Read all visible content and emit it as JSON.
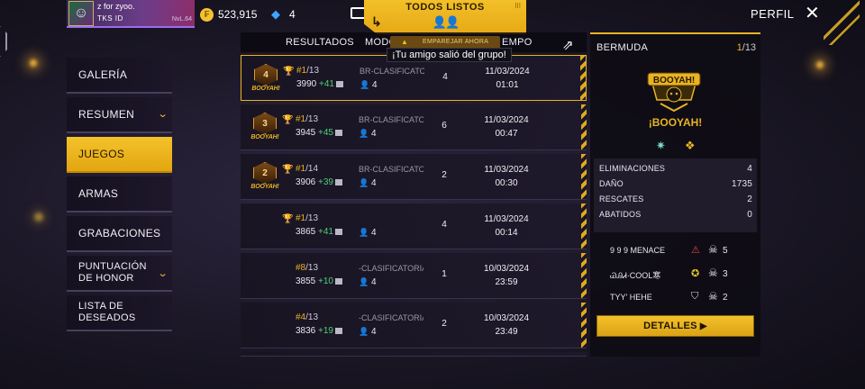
{
  "topbar": {
    "player_name": "z for zyoo.",
    "player_tag": "TKS    ID",
    "player_level": "NvL.64",
    "coins": "523,915",
    "diamonds": "4",
    "ready_text": "TODOS LISTOS",
    "ready_chip": "EMPAREJAR AHORA",
    "ready_mark": "III",
    "profile": "PERFIL"
  },
  "toast": "¡Tu amigo salió del grupo!",
  "sidebar": {
    "items": [
      {
        "label": "GALERÍA"
      },
      {
        "label": "RESUMEN"
      },
      {
        "label": "JUEGOS"
      },
      {
        "label": "ARMAS"
      },
      {
        "label": "GRABACIONES"
      },
      {
        "label": "PUNTUACIÓN DE HONOR"
      },
      {
        "label": "LISTA DE DESEADOS"
      }
    ]
  },
  "table": {
    "headers": {
      "results": "RESULTADOS",
      "mode": "MODO",
      "time": "EMPO"
    },
    "rows": [
      {
        "rank_badge": "4",
        "badge_word": "BOOYAH!",
        "position": "#1",
        "total": "/13",
        "score": "3990",
        "delta": "+41",
        "mode": "BR-CLASIFICATORIA",
        "squad": "4",
        "kills": "4",
        "date": "11/03/2024",
        "time": "01:01"
      },
      {
        "rank_badge": "3",
        "badge_word": "BOOYAH!",
        "position": "#1",
        "total": "/13",
        "score": "3945",
        "delta": "+45",
        "mode": "BR-CLASIFICATORIA",
        "squad": "4",
        "kills": "6",
        "date": "11/03/2024",
        "time": "00:47"
      },
      {
        "rank_badge": "2",
        "badge_word": "BOOYAH!",
        "position": "#1",
        "total": "/14",
        "score": "3906",
        "delta": "+39",
        "mode": "BR-CLASIFICATORIA",
        "squad": "4",
        "kills": "2",
        "date": "11/03/2024",
        "time": "00:30"
      },
      {
        "rank_badge": "",
        "badge_word": "",
        "position": "#1",
        "total": "/13",
        "score": "3865",
        "delta": "+41",
        "mode": "",
        "squad": "4",
        "kills": "4",
        "date": "11/03/2024",
        "time": "00:14"
      },
      {
        "rank_badge": "",
        "badge_word": "",
        "position": "#8",
        "total": "/13",
        "score": "3855",
        "delta": "+10",
        "mode": "-CLASIFICATORIA",
        "squad": "4",
        "kills": "1",
        "date": "10/03/2024",
        "time": "23:59"
      },
      {
        "rank_badge": "",
        "badge_word": "",
        "position": "#4",
        "total": "/13",
        "score": "3836",
        "delta": "+19",
        "mode": "-CLASIFICATORIA",
        "squad": "4",
        "kills": "2",
        "date": "10/03/2024",
        "time": "23:49"
      }
    ]
  },
  "detail": {
    "map": "BERMUDA",
    "position": "1",
    "total": "/13",
    "logo_text": "BOOYAH!",
    "title": "¡BOOYAH!",
    "stats": [
      {
        "label": "ELIMINACIONES",
        "value": "4"
      },
      {
        "label": "DAÑO",
        "value": "1735"
      },
      {
        "label": "RESCATES",
        "value": "2"
      },
      {
        "label": "ABATIDOS",
        "value": "0"
      }
    ],
    "teammates": [
      {
        "name": "9   9   9   MENACE",
        "count": "5"
      },
      {
        "name": "ᏊᎯᏗ·COOL寒",
        "count": "3"
      },
      {
        "name": "TYY'   HEHE",
        "count": "2"
      }
    ],
    "details_button": "DETALLES"
  },
  "colors": {
    "accent": "#e8b324",
    "positive": "#4fd07c"
  }
}
